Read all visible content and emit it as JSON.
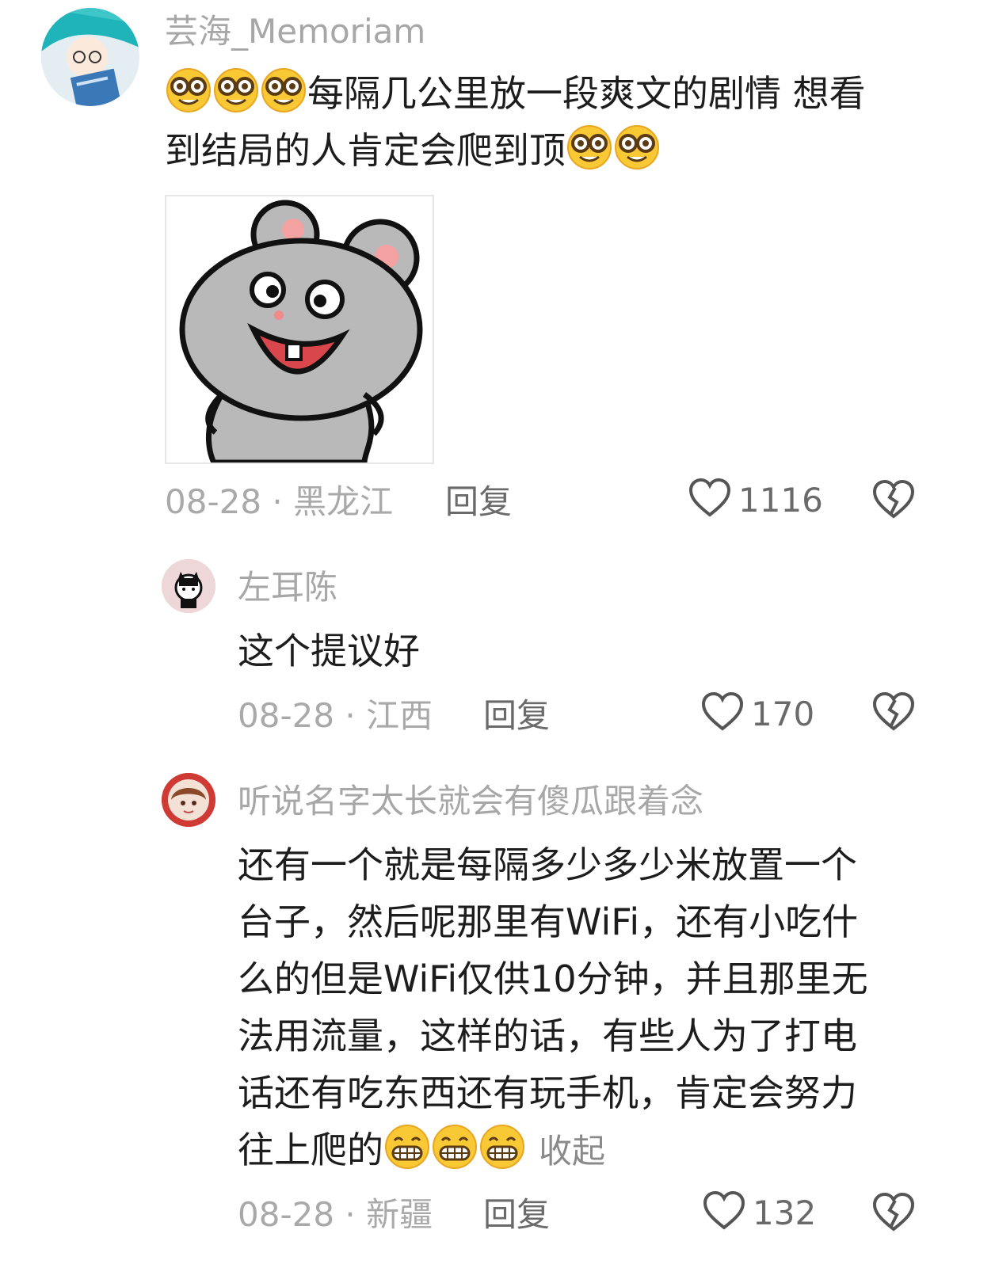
{
  "comments": [
    {
      "username": "芸海_Memoriam",
      "text_line1": "每隔几公里放一段爽文的剧情 想看",
      "text_line2": "到结局的人肯定会爬到顶",
      "date_loc": "08-28 · 黑龙江",
      "reply": "回复",
      "likes": "1116",
      "emoji_icon": "nerd-face-icon",
      "sticker_icon": "grinning-mouse-sticker"
    },
    {
      "username": "左耳陈",
      "text": "这个提议好",
      "date_loc": "08-28 · 江西",
      "reply": "回复",
      "likes": "170"
    },
    {
      "username": "听说名字太长就会有傻瓜跟着念",
      "lines": [
        "还有一个就是每隔多少多少米放置一个",
        "台子，然后呢那里有WiFi，还有小吃什",
        "么的但是WiFi仅供10分钟，并且那里无",
        "法用流量，这样的话，有些人为了打电",
        "话还有吃东西还有玩手机，肯定会努力"
      ],
      "last_line": "往上爬的",
      "collapse": "收起",
      "date_loc": "08-28 · 新疆",
      "reply": "回复",
      "likes": "132",
      "emoji_icon": "grin-face-icon"
    }
  ],
  "colors": {
    "username": "#a7a7a7",
    "meta": "#a9a9a9",
    "text": "#1d1d1d",
    "icon": "#555555"
  }
}
